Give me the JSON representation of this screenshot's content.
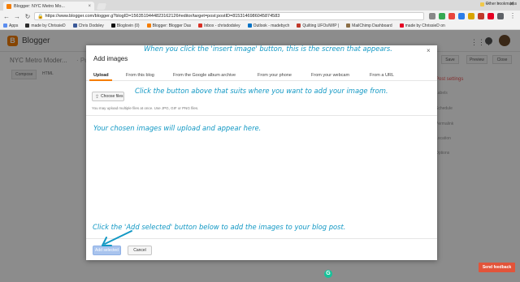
{
  "browser": {
    "tab_title": "Blogger: NYC Metro Mo...",
    "tab_close": "×",
    "url": "https://www.blogger.com/blogger.g?blogID=1563519444823162126#editor/target=post;postID=8153146986045874583",
    "bookmarks": [
      {
        "label": "Apps",
        "color": "#5b8def"
      },
      {
        "label": "made by ChrissieD",
        "color": "#2d2d2d"
      },
      {
        "label": "Chris Dodsley",
        "color": "#3b5998"
      },
      {
        "label": "Bloglovin (0)",
        "color": "#111111"
      },
      {
        "label": "Blogger: Blogger Das",
        "color": "#f57d00"
      },
      {
        "label": "Inbox - chrisdodsley",
        "color": "#d93025"
      },
      {
        "label": "Outlook - madebych",
        "color": "#0072c6"
      },
      {
        "label": "Quilting UFOs/WIP |",
        "color": "#c0392b"
      },
      {
        "label": "MailChimp Dashboard",
        "color": "#8b6f47"
      },
      {
        "label": "made by ChrissieD on",
        "color": "#e60023"
      }
    ],
    "other_bookmarks": "Other bookmarks"
  },
  "app": {
    "logo_letter": "B",
    "name": "Blogger"
  },
  "editor_bg": {
    "blog_title": "NYC Metro Moder...",
    "post_prefix": "· Po",
    "compose_label": "Compose",
    "html_label": "HTML",
    "save_label": "Save",
    "preview_label": "Preview",
    "close_label": "Close",
    "post_settings": "Post settings",
    "side_items": [
      "Labels",
      "Schedule",
      "Permalink",
      "Location",
      "Options"
    ]
  },
  "dialog": {
    "title": "Add images",
    "close": "×",
    "tabs": [
      "Upload",
      "From this blog",
      "From the Google album archive",
      "From your phone",
      "From your webcam",
      "From a URL"
    ],
    "choose_files": "Choose files",
    "hint": "You may upload multiple files at once. Use JPG, GIF or PNG files.",
    "add_selected": "Add selected",
    "cancel": "Cancel"
  },
  "widgets": {
    "grammarly": "G",
    "send_feedback": "Send feedback"
  },
  "annotations": {
    "a1": "When you click the 'insert image' button, this is the screen that appears.",
    "a2": "Click the button above that suits where you want to add your image from.",
    "a3": "Your chosen images will upload and appear here.",
    "a4": "Click the 'Add selected' button below to add the images to your blog post."
  },
  "colors": {
    "annotation": "#1298c4",
    "blogger_orange": "#f57d00",
    "feedback_red": "#e2543a",
    "add_button": "#a9c4ee"
  }
}
